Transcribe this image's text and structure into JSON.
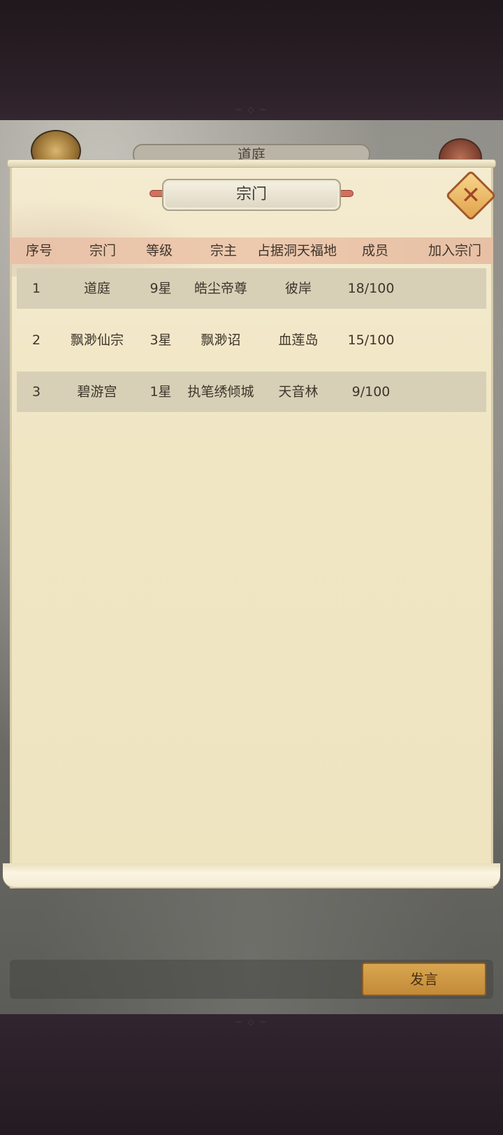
{
  "background": {
    "title": "道庭"
  },
  "dialog": {
    "title": "宗门",
    "close_icon": "close-x-icon"
  },
  "table": {
    "columns": [
      "序号",
      "宗门",
      "等级",
      "宗主",
      "占据洞天福地",
      "成员",
      "加入宗门"
    ],
    "rows": [
      {
        "index": "1",
        "sect": "道庭",
        "level": "9星",
        "leader": "皓尘帝尊",
        "territory": "彼岸",
        "members": "18/100",
        "join": ""
      },
      {
        "index": "2",
        "sect": "飘渺仙宗",
        "level": "3星",
        "leader": "飘渺诏",
        "territory": "血莲岛",
        "members": "15/100",
        "join": ""
      },
      {
        "index": "3",
        "sect": "碧游宫",
        "level": "1星",
        "leader": "执笔绣倾城",
        "territory": "天音林",
        "members": "9/100",
        "join": ""
      }
    ]
  },
  "chat": {
    "speak_label": "发言"
  },
  "colors": {
    "panel_bg": "#f0e6c4",
    "header_bg": "#edc9ae",
    "row_shade": "#d7d0b6",
    "button_gold": "#d9a64f"
  }
}
